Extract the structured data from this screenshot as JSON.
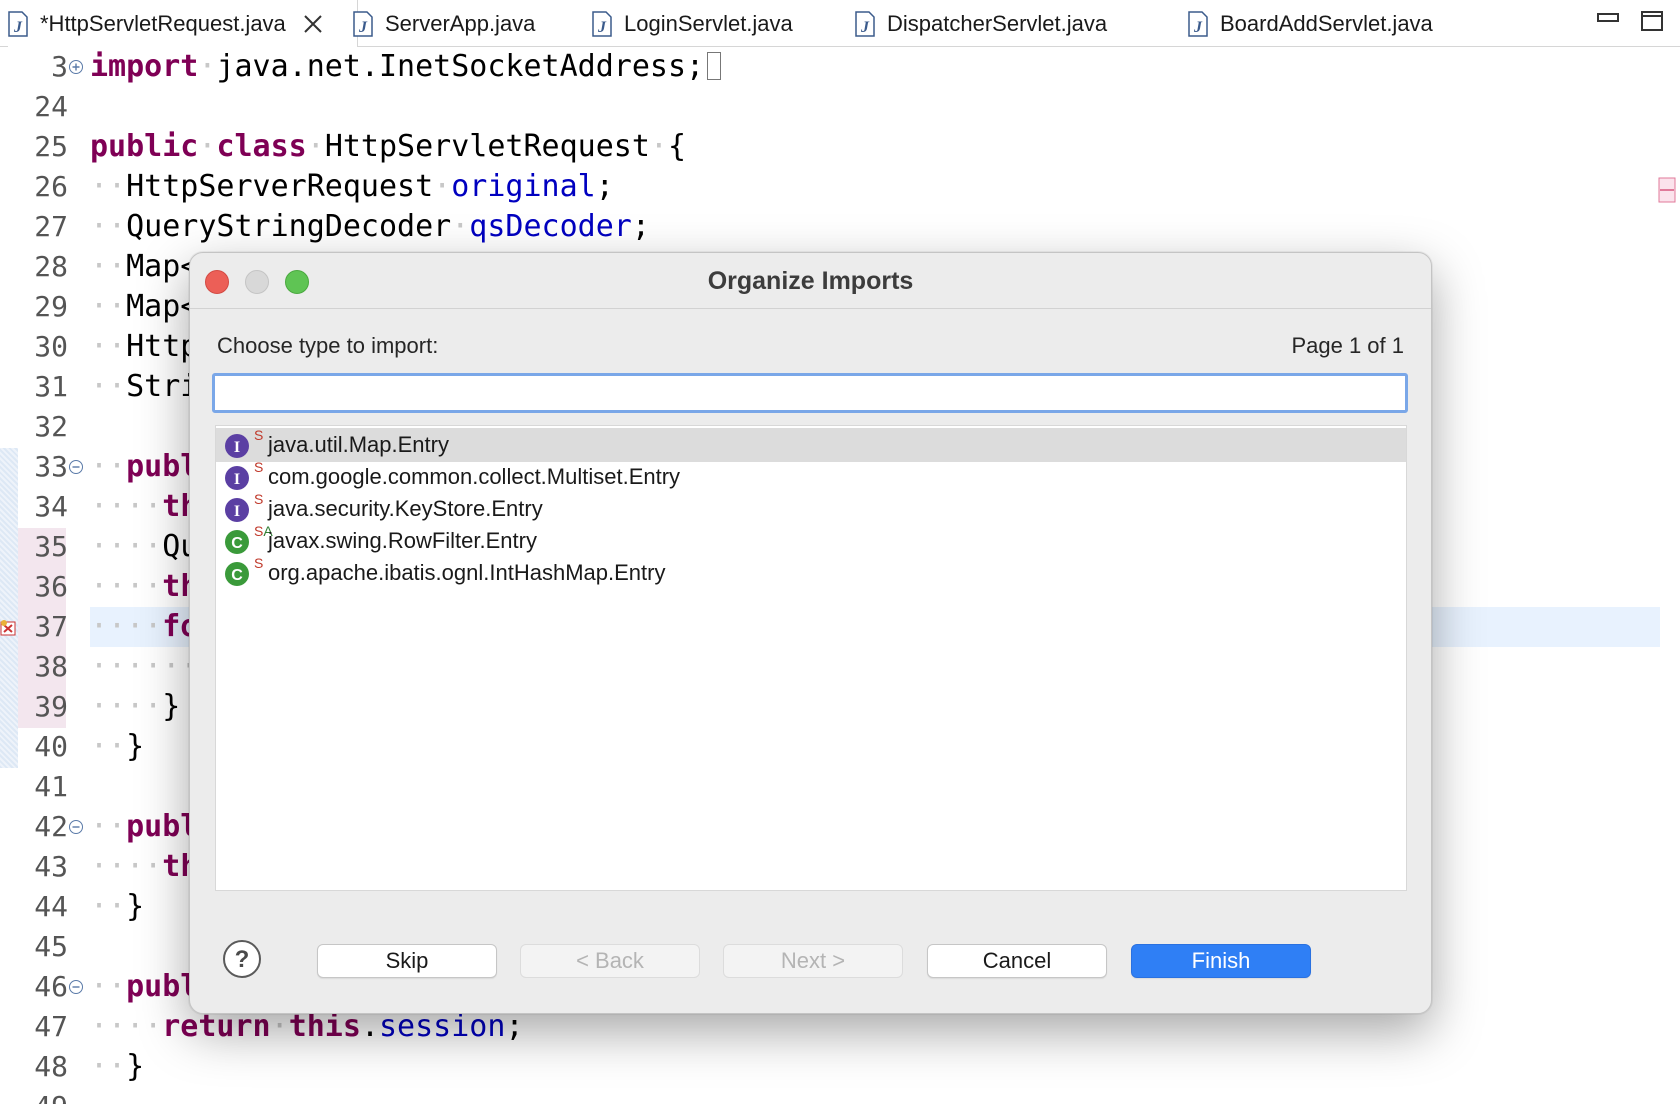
{
  "tabs": [
    {
      "label": "*HttpServletRequest.java",
      "active": true
    },
    {
      "label": "ServerApp.java"
    },
    {
      "label": "LoginServlet.java"
    },
    {
      "label": "DispatcherServlet.java"
    },
    {
      "label": "BoardAddServlet.java"
    }
  ],
  "editor": {
    "lines": [
      {
        "num": "3",
        "code": "import java.net.InetSocketAddress;"
      },
      {
        "num": "24"
      },
      {
        "num": "25",
        "code": "public class HttpServletRequest {"
      },
      {
        "num": "26",
        "code": "HttpServerRequest original;"
      },
      {
        "num": "27",
        "code": "QueryStringDecoder qsDecoder;"
      },
      {
        "num": "28",
        "code": "Map<"
      },
      {
        "num": "29",
        "code": "Map<"
      },
      {
        "num": "30",
        "code": "Http"
      },
      {
        "num": "31",
        "code": "Stri"
      },
      {
        "num": "32"
      },
      {
        "num": "33",
        "code": "publ"
      },
      {
        "num": "34",
        "code": "th"
      },
      {
        "num": "35",
        "code": "Qu"
      },
      {
        "num": "36",
        "code": "th"
      },
      {
        "num": "37",
        "code": "fo"
      },
      {
        "num": "38"
      },
      {
        "num": "39",
        "code": "}"
      },
      {
        "num": "40",
        "code": "}"
      },
      {
        "num": "41"
      },
      {
        "num": "42",
        "code": "publ"
      },
      {
        "num": "43",
        "code": "th"
      },
      {
        "num": "44",
        "code": "}"
      },
      {
        "num": "45"
      },
      {
        "num": "46",
        "code": "publ"
      },
      {
        "num": "47",
        "code": "return this.session;"
      },
      {
        "num": "48",
        "code": "}"
      },
      {
        "num": "49"
      }
    ]
  },
  "dialog": {
    "title": "Organize Imports",
    "prompt": "Choose type to import:",
    "page_indicator": "Page 1 of 1",
    "filter_value": "",
    "items": [
      {
        "label": "java.util.Map.Entry",
        "icon": "interface-icon",
        "badge": "S",
        "selected": true
      },
      {
        "label": "com.google.common.collect.Multiset.Entry",
        "icon": "interface-icon",
        "badge": "S"
      },
      {
        "label": "java.security.KeyStore.Entry",
        "icon": "interface-icon",
        "badge": "S"
      },
      {
        "label": "javax.swing.RowFilter.Entry",
        "icon": "class-icon",
        "badge": "SA"
      },
      {
        "label": "org.apache.ibatis.ognl.IntHashMap.Entry",
        "icon": "class-icon",
        "badge": "S"
      }
    ],
    "buttons": {
      "skip": "Skip",
      "back": "< Back",
      "next": "Next >",
      "cancel": "Cancel",
      "finish": "Finish"
    }
  },
  "colors": {
    "keyword": "#7f0055",
    "field": "#0000c0",
    "accent": "#2f7ff5",
    "interface_icon": "#5b3fa3",
    "class_icon": "#3a9a3a"
  }
}
